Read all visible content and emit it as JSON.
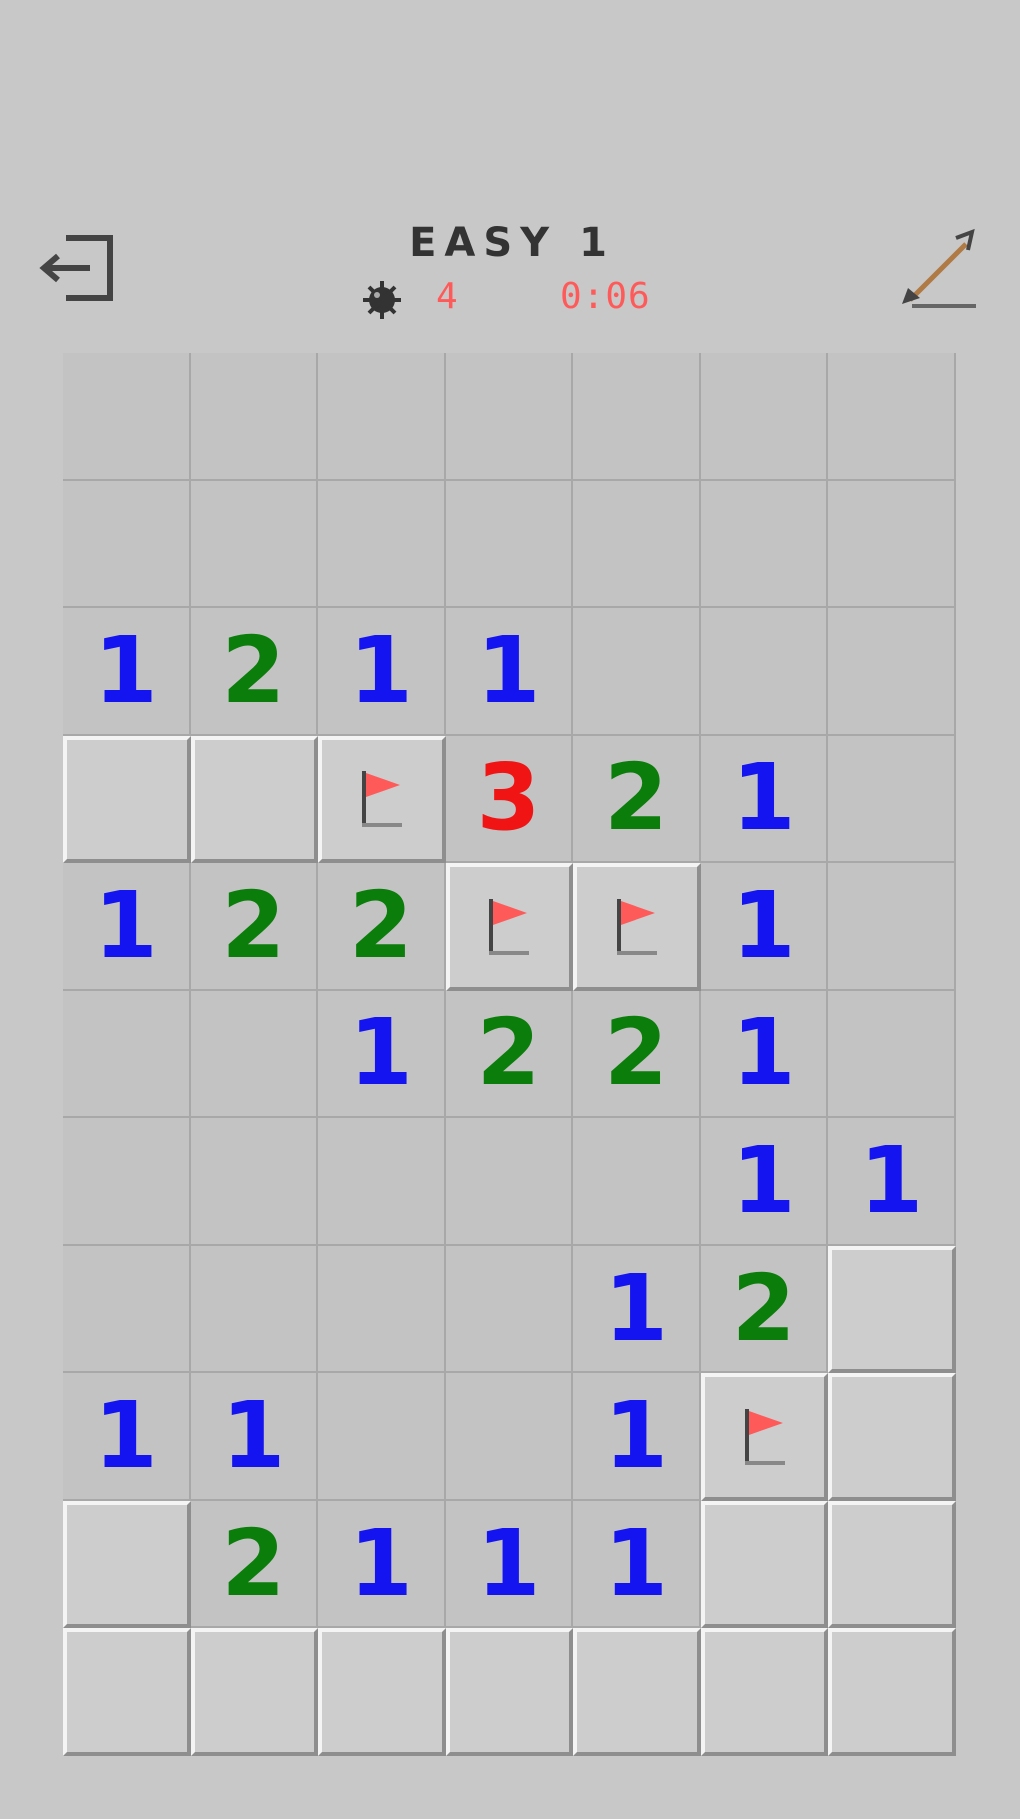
{
  "header": {
    "exit_icon": "exit-door-icon",
    "title": "EASY 1",
    "mine_icon": "mine-icon",
    "mines_remaining": "4",
    "timer": "0:06",
    "tool_icon": "shovel-icon"
  },
  "colors": {
    "background": "#c8c8c8",
    "counter": "#ff5a5a",
    "number_1": "#1414f0",
    "number_2": "#0a7d0a",
    "number_3": "#f01414",
    "flag": "#ff5a5a"
  },
  "board": {
    "columns": 7,
    "legend": {
      "R": "revealed-empty",
      "H": "hidden",
      "F": "flagged",
      "1": "revealed-number",
      "2": "revealed-number",
      "3": "revealed-number"
    },
    "rows": [
      [
        "R",
        "R",
        "R",
        "R",
        "R",
        "R",
        "R"
      ],
      [
        "R",
        "R",
        "R",
        "R",
        "R",
        "R",
        "R"
      ],
      [
        "1",
        "2",
        "1",
        "1",
        "R",
        "R",
        "R"
      ],
      [
        "H",
        "H",
        "F",
        "3",
        "2",
        "1",
        "R"
      ],
      [
        "1",
        "2",
        "2",
        "F",
        "F",
        "1",
        "R"
      ],
      [
        "R",
        "R",
        "1",
        "2",
        "2",
        "1",
        "R"
      ],
      [
        "R",
        "R",
        "R",
        "R",
        "R",
        "1",
        "1"
      ],
      [
        "R",
        "R",
        "R",
        "R",
        "1",
        "2",
        "H"
      ],
      [
        "1",
        "1",
        "R",
        "R",
        "1",
        "F",
        "H"
      ],
      [
        "H",
        "2",
        "1",
        "1",
        "1",
        "H",
        "H"
      ],
      [
        "H",
        "H",
        "H",
        "H",
        "H",
        "H",
        "H"
      ]
    ]
  }
}
